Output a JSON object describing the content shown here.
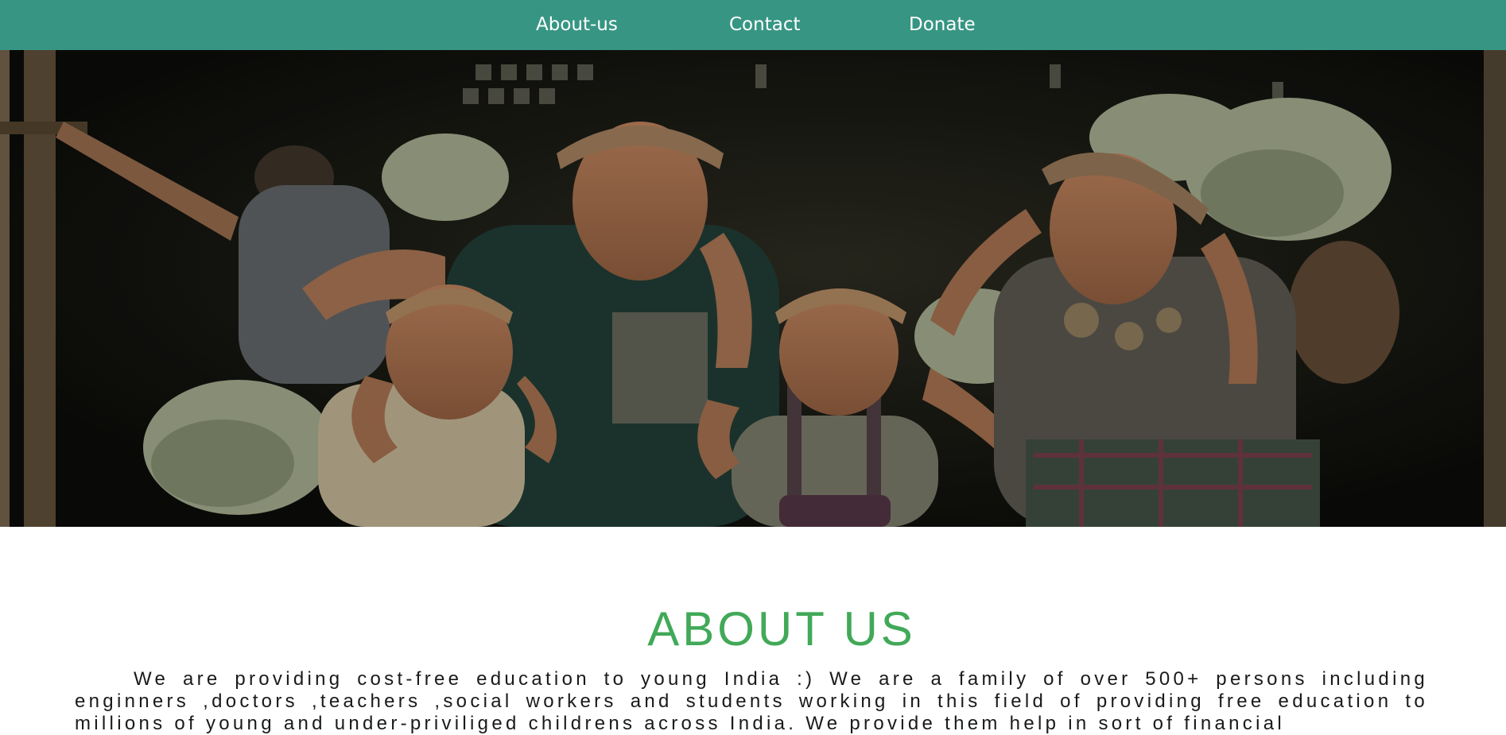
{
  "nav": {
    "links": [
      {
        "label": "About-us"
      },
      {
        "label": "Contact"
      },
      {
        "label": "Donate"
      }
    ]
  },
  "hero": {
    "image_description": "Family carrying banana bunches"
  },
  "about": {
    "title": "ABOUT US",
    "text": "We are providing cost-free education to young India :) We are a family of over 500+ persons including enginners ,doctors ,teachers ,social workers and students working in this field of providing free education to millions of young and under-priviliged childrens across India. We provide them help in sort of financial"
  },
  "colors": {
    "nav_bg": "#379583",
    "nav_text": "#ffffff",
    "title": "#41a958",
    "body_text": "#1a1a1a"
  }
}
